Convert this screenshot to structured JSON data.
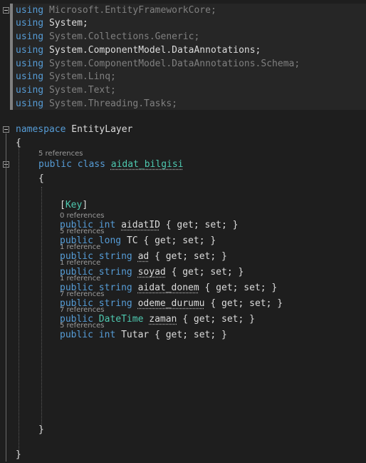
{
  "usings": [
    {
      "keyword": "using",
      "ns": "Microsoft.EntityFrameworkCore;"
    },
    {
      "keyword": "using",
      "ns": "System;"
    },
    {
      "keyword": "using",
      "ns": "System.Collections.Generic;"
    },
    {
      "keyword": "using",
      "ns": "System.ComponentModel.DataAnnotations;"
    },
    {
      "keyword": "using",
      "ns": "System.ComponentModel.DataAnnotations.Schema;"
    },
    {
      "keyword": "using",
      "ns": "System.Linq;"
    },
    {
      "keyword": "using",
      "ns": "System.Text;"
    },
    {
      "keyword": "using",
      "ns": "System.Threading.Tasks;"
    }
  ],
  "namespace": {
    "keyword": "namespace",
    "name": "EntityLayer",
    "open": "{",
    "close": "}"
  },
  "class": {
    "refs": "5 references",
    "kw1": "public",
    "kw2": "class",
    "name": "aidat_bilgisi",
    "open": "{",
    "close": "}"
  },
  "attribute": {
    "open": "[",
    "name": "Key",
    "close": "]"
  },
  "properties": [
    {
      "refs": "0 references",
      "mod": "public",
      "type": "int",
      "type_kind": "kw",
      "name": "aidatID",
      "accessors": "{ get; set; }"
    },
    {
      "refs": "5 references",
      "mod": "public",
      "type": "long",
      "type_kind": "kw",
      "name": "TC",
      "accessors": "{ get; set; }"
    },
    {
      "refs": "1 reference",
      "mod": "public",
      "type": "string",
      "type_kind": "kw",
      "name": "ad",
      "accessors": "{ get; set; }"
    },
    {
      "refs": "1 reference",
      "mod": "public",
      "type": "string",
      "type_kind": "kw",
      "name": "soyad",
      "accessors": "{ get; set; }"
    },
    {
      "refs": "1 reference",
      "mod": "public",
      "type": "string",
      "type_kind": "kw",
      "name": "aidat_donem",
      "accessors": "{ get; set; }"
    },
    {
      "refs": "7 references",
      "mod": "public",
      "type": "string",
      "type_kind": "kw",
      "name": "odeme_durumu",
      "accessors": "{ get; set; }"
    },
    {
      "refs": "7 references",
      "mod": "public",
      "type": "DateTime",
      "type_kind": "ty",
      "name": "zaman",
      "accessors": "{ get; set; }"
    },
    {
      "refs": "5 references",
      "mod": "public",
      "type": "int",
      "type_kind": "kw",
      "name": "Tutar",
      "accessors": "{ get; set; }"
    }
  ],
  "colors": {
    "background": "#1e1e1e",
    "keyword": "#569cd6",
    "type": "#4ec9b0",
    "text": "#dcdcdc",
    "dimmed": "#808080",
    "attribute": "#f48c2c",
    "codelens": "#9a9a9a"
  }
}
